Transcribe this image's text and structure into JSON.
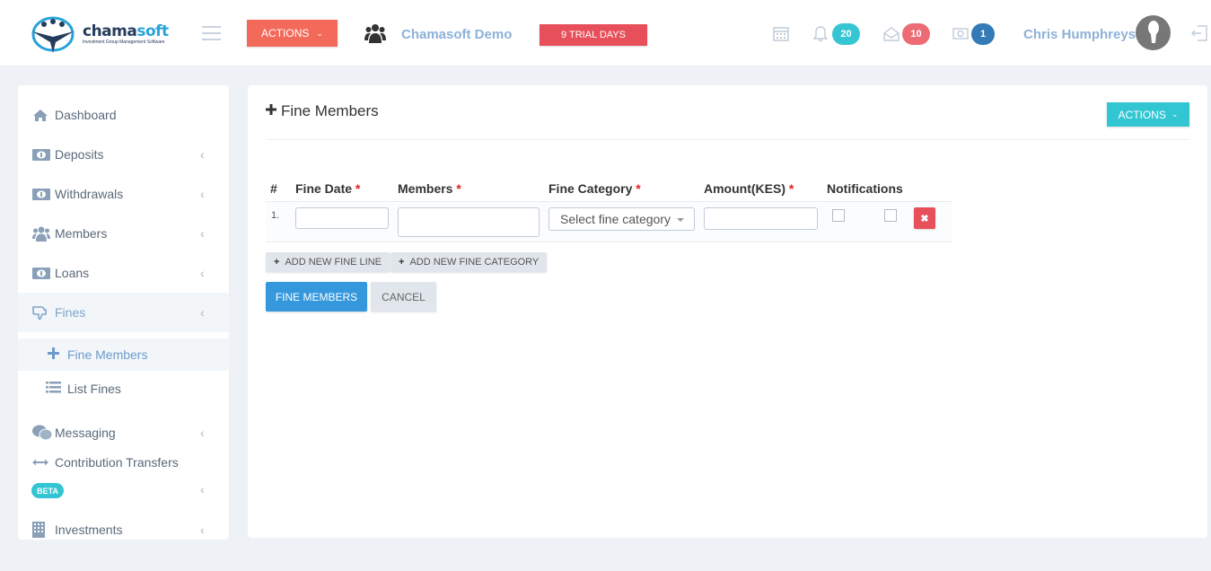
{
  "header": {
    "logo": {
      "name_main": "chama",
      "name_accent": "soft",
      "tagline": "Investment Group Management Software"
    },
    "actions_label": "ACTIONS",
    "group_name": "Chamasoft Demo",
    "trial_label": "9 TRIAL DAYS",
    "notifications_count": "20",
    "messages_count": "10",
    "payments_count": "1",
    "user_name": "Chris Humphreys",
    "colors": {
      "notifications": "#36c6d3",
      "messages": "#ed6b75",
      "payments": "#337ab7"
    }
  },
  "sidebar": {
    "items": [
      {
        "label": "Dashboard",
        "icon": "home-icon"
      },
      {
        "label": "Deposits",
        "icon": "money-icon"
      },
      {
        "label": "Withdrawals",
        "icon": "money-icon"
      },
      {
        "label": "Members",
        "icon": "users-icon"
      },
      {
        "label": "Loans",
        "icon": "money-icon"
      },
      {
        "label": "Fines",
        "icon": "thumbs-down-icon",
        "active": true
      },
      {
        "label": "Messaging",
        "icon": "chat-icon"
      },
      {
        "label": "Contribution Transfers",
        "icon": "arrows-horizontal-icon",
        "badge": "BETA"
      },
      {
        "label": "Investments",
        "icon": "building-icon"
      }
    ],
    "fines_submenu": [
      {
        "label": "Fine Members",
        "icon": "plus-icon",
        "active": true
      },
      {
        "label": "List Fines",
        "icon": "list-icon"
      }
    ]
  },
  "main": {
    "title": "Fine Members",
    "actions_label": "ACTIONS",
    "table": {
      "columns": [
        {
          "label": "#",
          "required": false
        },
        {
          "label": "Fine Date",
          "required": true
        },
        {
          "label": "Members",
          "required": true
        },
        {
          "label": "Fine Category",
          "required": true
        },
        {
          "label": "Amount(KES)",
          "required": true
        },
        {
          "label": "Notifications",
          "required": false
        }
      ],
      "required_mark": "*",
      "rows": [
        {
          "number": "1.",
          "fine_date": "",
          "members": "",
          "fine_category_placeholder": "Select fine category",
          "amount": "",
          "notify_sms": false,
          "notify_email": false
        }
      ]
    },
    "add_fine_line_label": "ADD NEW FINE LINE",
    "add_fine_category_label": "ADD NEW FINE CATEGORY",
    "submit_label": "FINE MEMBERS",
    "cancel_label": "CANCEL"
  }
}
